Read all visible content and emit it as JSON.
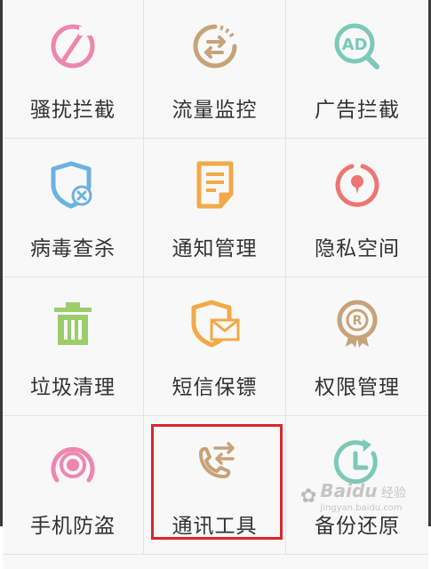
{
  "tiles": [
    {
      "label": "骚扰拦截",
      "icon": "block-icon",
      "color": "#ee86ad"
    },
    {
      "label": "流量监控",
      "icon": "traffic-icon",
      "color": "#c7a37a"
    },
    {
      "label": "广告拦截",
      "icon": "ad-search-icon",
      "color": "#7bc9b7"
    },
    {
      "label": "病毒查杀",
      "icon": "shield-virus-icon",
      "color": "#6bb2e1"
    },
    {
      "label": "通知管理",
      "icon": "document-icon",
      "color": "#f2a947"
    },
    {
      "label": "隐私空间",
      "icon": "privacy-icon",
      "color": "#ee7571"
    },
    {
      "label": "垃圾清理",
      "icon": "trash-icon",
      "color": "#9ccd6a"
    },
    {
      "label": "短信保镖",
      "icon": "sms-shield-icon",
      "color": "#f2a947"
    },
    {
      "label": "权限管理",
      "icon": "permission-icon",
      "color": "#c7a37a"
    },
    {
      "label": "手机防盗",
      "icon": "antitheft-icon",
      "color": "#ee86ad"
    },
    {
      "label": "通讯工具",
      "icon": "call-tools-icon",
      "color": "#c7a37a"
    },
    {
      "label": "备份还原",
      "icon": "backup-icon",
      "color": "#7bc9b7"
    }
  ],
  "watermark": {
    "brand": "Baidu",
    "sub": "经验",
    "url": "jingyan.baidu.com"
  }
}
